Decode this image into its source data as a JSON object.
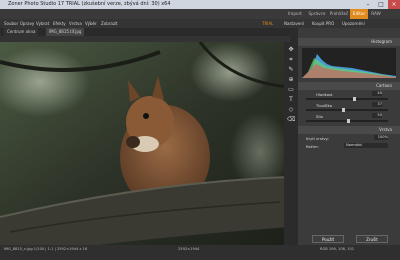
{
  "app": {
    "title": "Zoner Photo Studio 17 TRIAL (zkušební verze, zbývá dní: 30) x64"
  },
  "modes": [
    {
      "label": "Import"
    },
    {
      "label": "Správce"
    },
    {
      "label": "Prohlížeč"
    },
    {
      "label": "Editor",
      "active": true
    },
    {
      "label": "RAW"
    }
  ],
  "menus": [
    "Soubor",
    "Úpravy",
    "Vybrat",
    "Efekty",
    "Vrstva",
    "Výběr",
    "Zobrazit"
  ],
  "toolbar_right": {
    "trial": "TRIAL",
    "buy": "Koupit PRO",
    "update": "Nastavení",
    "notify": "Upozornění"
  },
  "doc_tabs": [
    {
      "label": "Centrum okna"
    },
    {
      "label": "IMG_8815.tif.jpg",
      "active": true
    }
  ],
  "panel": {
    "histogram_title": "Histogram",
    "curves_title": "Cartoon",
    "controls": [
      {
        "label": "Hladkost",
        "value": "40",
        "pct": 0.58
      },
      {
        "label": "Tloušťka",
        "value": "37",
        "pct": 0.44
      },
      {
        "label": "Síla",
        "value": "50",
        "pct": 0.5
      }
    ],
    "blend_title": "Vrstva",
    "opacity_label": "Krytí vrstvy:",
    "opacity_value": "100%",
    "mode_label": "Režim:",
    "mode_value": "Normální",
    "apply": "Použít",
    "cancel": "Zrušit"
  },
  "status": {
    "left": "IMG_8815_n.jpg  1/100  |  1:1  |  2592×1944 x 16",
    "mid": "2592×1944",
    "right": "RGB 106, 108, 101"
  },
  "colors": {
    "accent": "#e18a1e",
    "title_bar": "#cfd6df",
    "panel_bg": "#3b3b3b"
  }
}
